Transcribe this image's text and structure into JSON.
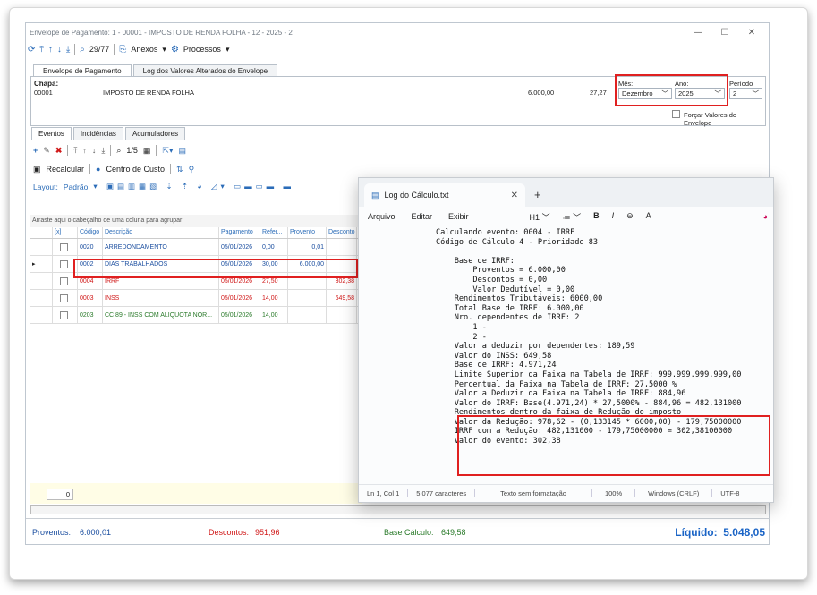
{
  "window": {
    "title": "Envelope de Pagamento: 1 - 00001 - IMPOSTO DE RENDA FOLHA - 12 - 2025 - 2"
  },
  "toolbar": {
    "record_counter": "29/77",
    "anexos": "Anexos",
    "processos": "Processos"
  },
  "tabs_top": [
    "Envelope de Pagamento",
    "Log dos Valores Alterados do Envelope"
  ],
  "header": {
    "chapa_label": "Chapa:",
    "chapa": "00001",
    "descricao": "IMPOSTO DE RENDA FOLHA",
    "valor1": "6.000,00",
    "valor2": "27,27",
    "mes_label": "Mês:",
    "mes": "Dezembro",
    "ano_label": "Ano:",
    "ano": "2025",
    "periodo_label": "Período",
    "periodo": "2",
    "forcar_valores": "Forçar Valores do Envelope"
  },
  "tabs_mid": [
    "Eventos",
    "Incidências",
    "Acumuladores"
  ],
  "event_toolbar": {
    "counter": "1/5",
    "recalcular": "Recalcular",
    "centro_custo": "Centro de Custo",
    "layout": "Layout:",
    "padrao": "Padrão"
  },
  "grid": {
    "group_hint": "Arraste aqui o cabeçalho de uma coluna para agrupar",
    "columns": [
      "[x]",
      "Código",
      "Descrição",
      "Pagamento",
      "Refer...",
      "Provento",
      "Desconto"
    ],
    "rows": [
      {
        "codigo": "0020",
        "descricao": "ARREDONDAMENTO",
        "pagamento": "05/01/2026",
        "referencia": "0,00",
        "provento": "0,01",
        "desconto": "",
        "color": "blue"
      },
      {
        "codigo": "0002",
        "descricao": "DIAS TRABALHADOS",
        "pagamento": "05/01/2026",
        "referencia": "30,00",
        "provento": "6.000,00",
        "desconto": "",
        "color": "blue"
      },
      {
        "codigo": "0004",
        "descricao": "IRRF",
        "pagamento": "05/01/2026",
        "referencia": "27,50",
        "provento": "",
        "desconto": "302,38",
        "color": "red"
      },
      {
        "codigo": "0003",
        "descricao": "INSS",
        "pagamento": "05/01/2026",
        "referencia": "14,00",
        "provento": "",
        "desconto": "649,58",
        "color": "red"
      },
      {
        "codigo": "0203",
        "descricao": "CC 89 - INSS COM ALIQUOTA NOR...",
        "pagamento": "05/01/2026",
        "referencia": "14,00",
        "provento": "",
        "desconto": "",
        "color": "green"
      }
    ],
    "footer_count": "0"
  },
  "status": {
    "proventos_label": "Proventos:",
    "proventos": "6.000,01",
    "descontos_label": "Descontos:",
    "descontos": "951,96",
    "base_label": "Base Cálculo:",
    "base": "649,58",
    "liquido_label": "Líquido:",
    "liquido": "5.048,05"
  },
  "notepad": {
    "tab_title": "Log do Cálculo.txt",
    "menu": [
      "Arquivo",
      "Editar",
      "Exibir"
    ],
    "heading_btn": "H1",
    "content_lines": [
      "Calculando evento: 0004 - IRRF",
      "Código de Cálculo 4 - Prioridade 83",
      "",
      "    Base de IRRF:",
      "        Proventos = 6.000,00",
      "        Descontos = 0,00",
      "        Valor Dedutível = 0,00",
      "    Rendimentos Tributáveis: 6000,00",
      "    Total Base de IRRF: 6.000,00",
      "    Nro. dependentes de IRRF: 2",
      "        1 -",
      "        2 -",
      "    Valor a deduzir por dependentes: 189,59",
      "    Valor do INSS: 649,58",
      "    Base de IRRF: 4.971,24",
      "    Limite Superior da Faixa na Tabela de IRRF: 999.999.999.999,00",
      "    Percentual da Faixa na Tabela de IRRF: 27,5000 %",
      "    Valor a Deduzir da Faixa na Tabela de IRRF: 884,96",
      "    Valor do IRRF: Base(4.971,24) * 27,5000% - 884,96 = 482,131000",
      "    Rendimentos dentro da faixa de Redução do imposto",
      "    Valor da Redução: 978,62 - (0,133145 * 6000,00) - 179,75000000",
      "    IRRF com a Redução: 482,131000 - 179,75000000 = 302,38100000",
      "    Valor do evento: 302,38"
    ],
    "status": [
      "Ln 1, Col 1",
      "5.077 caracteres",
      "Texto sem formatação",
      "100%",
      "Windows (CRLF)",
      "UTF-8"
    ]
  }
}
